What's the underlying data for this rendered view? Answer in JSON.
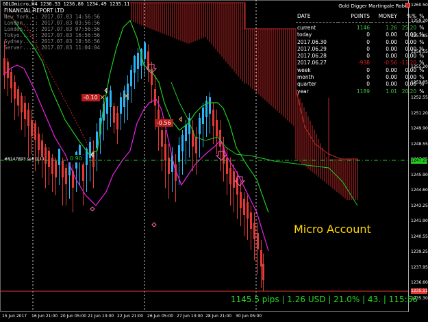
{
  "header": {
    "symbol_line": "GOLDmicro,H4  1236.53 1236.80 1234.49 1235.11",
    "report_title": "FINANCIAL REPORT  LTD",
    "robot_name": "Gold Digger Martingale Robot"
  },
  "times": [
    {
      "city": "New York..:",
      "value": "2017.07.03 14:56:56"
    },
    {
      "city": "London....:",
      "value": "2017.07.03 03:56:56"
    },
    {
      "city": "London....:",
      "value": "2017.07.03 07:56:56"
    },
    {
      "city": "Tokyo.....:",
      "value": "2017.07.03 16:56:56"
    },
    {
      "city": "Sydney....:",
      "value": "2017.07.03 18:56:56"
    },
    {
      "city": "Server....:",
      "value": "2017.07.03 11:04:04"
    }
  ],
  "stats": {
    "headers": [
      "DATE",
      "POINTS",
      "MONEY",
      "%%",
      "%"
    ],
    "rows": [
      {
        "label": "current",
        "points": "1146",
        "money": "1.26",
        "pct": "25.20",
        "unit": "%",
        "color": "#3ec33e"
      },
      {
        "label": "today",
        "points": "0",
        "money": "0.00",
        "pct": "0.00",
        "unit": "%",
        "color": "#ffffff"
      },
      {
        "label": "2017.06.30",
        "points": "0",
        "money": "0.00",
        "pct": "0.00",
        "unit": "%",
        "color": "#ffffff"
      },
      {
        "label": "2017.06.29",
        "points": "0",
        "money": "0.00",
        "pct": "0.00",
        "unit": "%",
        "color": "#ffffff"
      },
      {
        "label": "2017.06.28",
        "points": "0",
        "money": "0.00",
        "pct": "0.00",
        "unit": "%",
        "color": "#ffffff"
      },
      {
        "label": "2017.06.27",
        "points": "-938",
        "money": "-0.56",
        "pct": "-11.20",
        "unit": "%",
        "color": "#e02020"
      },
      {
        "label": "week",
        "points": "0",
        "money": "0.00",
        "pct": "0.00",
        "unit": "%",
        "color": "#ffffff"
      },
      {
        "label": "month",
        "points": "0",
        "money": "0.00",
        "pct": "0.00",
        "unit": "%",
        "color": "#ffffff"
      },
      {
        "label": "quarter",
        "points": "0",
        "money": "0.00",
        "pct": "0.00",
        "unit": "%",
        "color": "#ffffff"
      },
      {
        "label": "year",
        "points": "1189",
        "money": "1.01",
        "pct": "20.20",
        "unit": "%",
        "color": "#3ec33e"
      }
    ]
  },
  "y_axis": [
    "1260.50",
    "1259.20",
    "1257.85",
    "1256.55",
    "1255.20",
    "1253.85",
    "1252.55",
    "1251.20",
    "1249.90",
    "1248.55",
    "1247.25",
    "1245.90",
    "1244.60",
    "1243.25",
    "1241.90",
    "1240.55",
    "1239.25",
    "1237.95",
    "1236.60",
    "1235.30"
  ],
  "x_axis": [
    "15 Jun 2017",
    "16 Jun 21:00",
    "20 Jun 05:00",
    "21 Jun 13:00",
    "22 Jun 21:00",
    "26 Jun 05:00",
    "27 Jun 13:00",
    "28 Jun 21:00",
    "30 Jun 05:00"
  ],
  "order_label": "#8147893 sell 0.11",
  "price_tags": [
    {
      "text": "-0.10",
      "bg": "#b71c1c"
    },
    {
      "text": "-0.56",
      "bg": "#b71c1c"
    },
    {
      "text": "0.90",
      "bg": "#000000"
    }
  ],
  "current_price": "1235.11",
  "entry_price": "1247.25",
  "overlay": {
    "account_type": "Micro Account",
    "summary": "1145.5 pips | 1.26 USD | 21.0% | 43. | 115:56"
  },
  "colors": {
    "bull": "#29b6f6",
    "bear": "#e53935",
    "ma_fast": "#ee22ee",
    "ma_slow": "#22cc22",
    "cloud": "#c62828",
    "accent_text": "#ffd700",
    "pips_text": "#22dd22"
  }
}
